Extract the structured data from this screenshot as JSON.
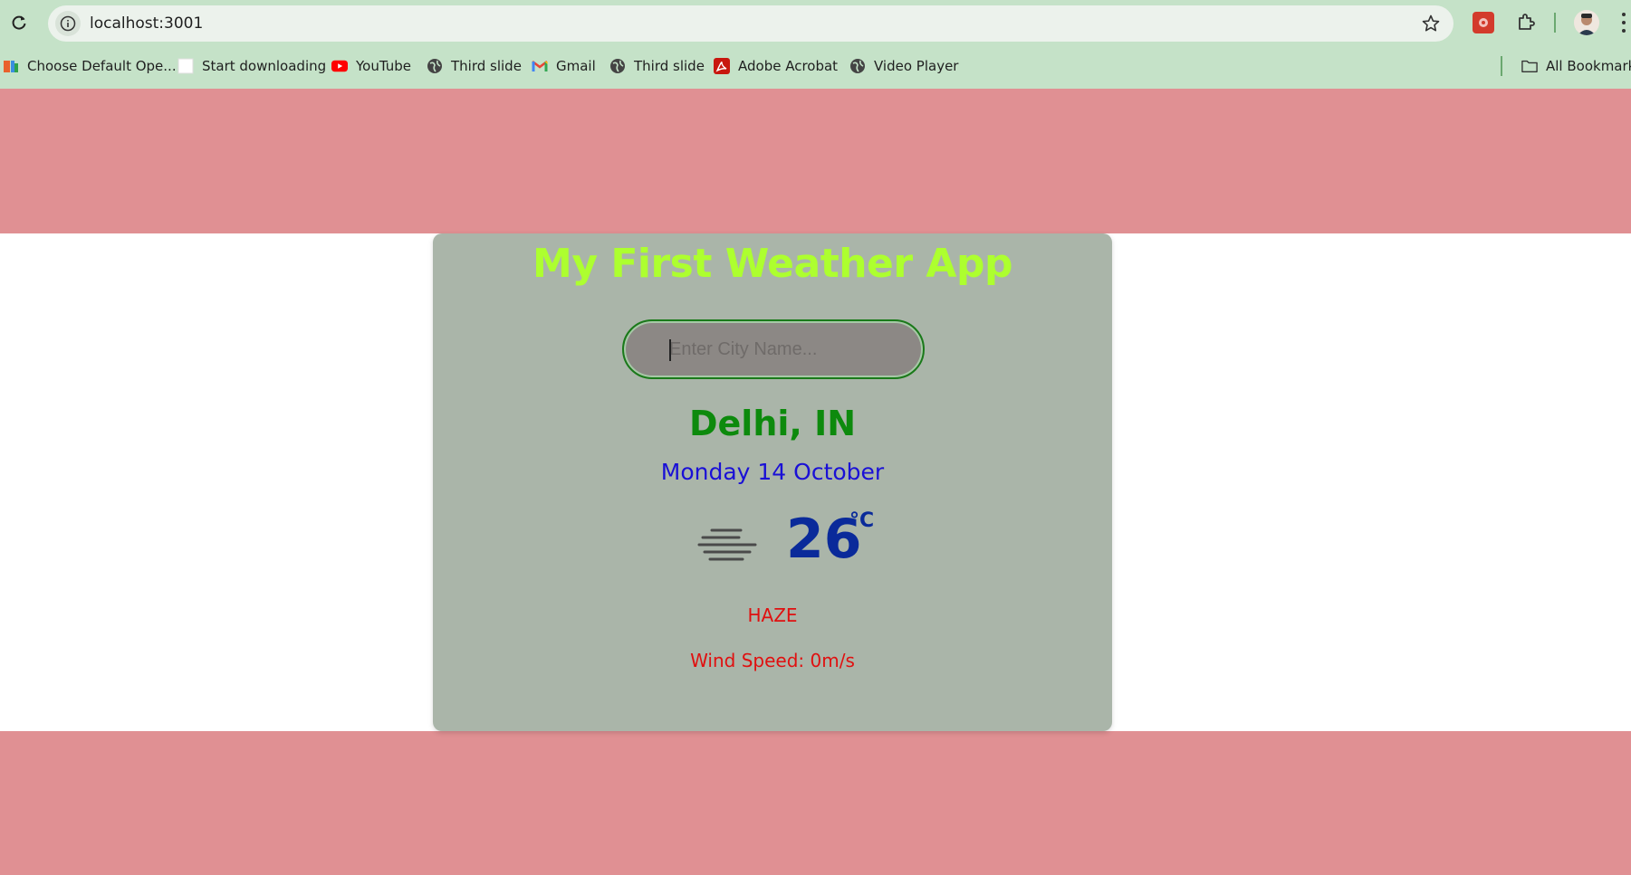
{
  "browser": {
    "url": "localhost:3001",
    "bookmarks": [
      {
        "label": "Choose Default Ope...",
        "icon": "office-icon"
      },
      {
        "label": "Start downloading",
        "icon": "blank-page-icon"
      },
      {
        "label": "YouTube",
        "icon": "youtube-icon"
      },
      {
        "label": "Third slide",
        "icon": "globe-icon"
      },
      {
        "label": "Gmail",
        "icon": "gmail-icon"
      },
      {
        "label": "Third slide",
        "icon": "globe-icon"
      },
      {
        "label": "Adobe Acrobat",
        "icon": "acrobat-icon"
      },
      {
        "label": "Video Player",
        "icon": "globe-icon"
      }
    ],
    "all_bookmarks": "All Bookmarks"
  },
  "app": {
    "title": "My First Weather App",
    "search_placeholder": "Enter City Name...",
    "city": "Delhi, IN",
    "date": "Monday 14 October",
    "temperature": "26",
    "unit": "°C",
    "condition": "HAZE",
    "wind_label": "Wind Speed: ",
    "wind_value": "0m/s",
    "weather_icon": "haze-icon"
  },
  "colors": {
    "band": "#e09093",
    "card": "#aab5a9",
    "title": "#adff2f",
    "city": "#0d8a0d",
    "date": "#1a10d6",
    "temp": "#0a2a9a",
    "alert": "#e01010"
  }
}
